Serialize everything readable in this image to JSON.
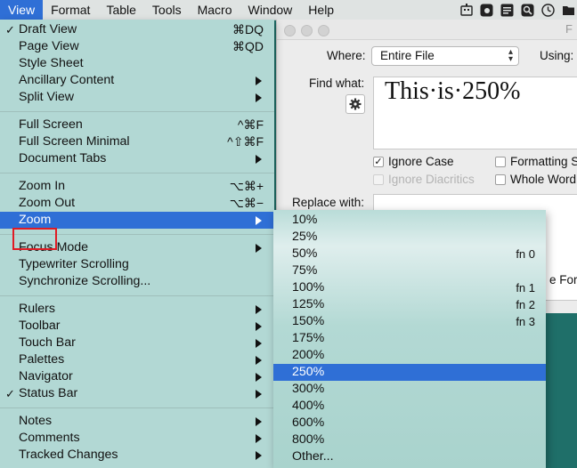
{
  "menubar": {
    "items": [
      "View",
      "Format",
      "Table",
      "Tools",
      "Macro",
      "Window",
      "Help"
    ],
    "active": "View"
  },
  "find_window": {
    "title": "F",
    "where_label": "Where:",
    "where_value": "Entire File",
    "using_label": "Using:",
    "find_label": "Find what:",
    "find_value": "This·is·250%",
    "replace_label": "Replace with:",
    "checkboxes": [
      {
        "label": "Ignore Case",
        "checked": true,
        "enabled": true
      },
      {
        "label": "Formatting S",
        "checked": false,
        "enabled": true
      },
      {
        "label": "Ignore Diacritics",
        "checked": false,
        "enabled": false
      },
      {
        "label": "Whole Word",
        "checked": false,
        "enabled": true
      }
    ],
    "replace_formatting_label": "e Forr"
  },
  "view_menu": {
    "items": [
      {
        "label": "Draft View",
        "shortcut": "⌘DQ",
        "checked": true
      },
      {
        "label": "Page View",
        "shortcut": "⌘QD"
      },
      {
        "label": "Style Sheet"
      },
      {
        "label": "Ancillary Content",
        "submenu": true
      },
      {
        "label": "Split View",
        "submenu": true
      },
      {
        "label": "Full Screen",
        "shortcut": "^⌘F"
      },
      {
        "label": "Full Screen Minimal",
        "shortcut": "^⇧⌘F"
      },
      {
        "label": "Document Tabs",
        "submenu": true
      },
      {
        "label": "Zoom In",
        "shortcut": "⌥⌘+"
      },
      {
        "label": "Zoom Out",
        "shortcut": "⌥⌘−"
      },
      {
        "label": "Zoom",
        "submenu": true,
        "highlighted": true
      },
      {
        "label": "Focus Mode",
        "submenu": true
      },
      {
        "label": "Typewriter Scrolling"
      },
      {
        "label": "Synchronize Scrolling..."
      },
      {
        "label": "Rulers",
        "submenu": true
      },
      {
        "label": "Toolbar",
        "submenu": true
      },
      {
        "label": "Touch Bar",
        "submenu": true
      },
      {
        "label": "Palettes",
        "submenu": true
      },
      {
        "label": "Navigator",
        "submenu": true
      },
      {
        "label": "Status Bar",
        "submenu": true,
        "checked": true
      },
      {
        "label": "Notes",
        "submenu": true
      },
      {
        "label": "Comments",
        "submenu": true
      },
      {
        "label": "Tracked Changes",
        "submenu": true
      }
    ]
  },
  "zoom_submenu": {
    "items": [
      {
        "label": "10%"
      },
      {
        "label": "25%"
      },
      {
        "label": "50%",
        "shortcut": "fn 0"
      },
      {
        "label": "75%"
      },
      {
        "label": "100%",
        "shortcut": "fn 1"
      },
      {
        "label": "125%",
        "shortcut": "fn 2"
      },
      {
        "label": "150%",
        "shortcut": "fn 3"
      },
      {
        "label": "175%"
      },
      {
        "label": "200%"
      },
      {
        "label": "250%",
        "highlighted": true
      },
      {
        "label": "300%"
      },
      {
        "label": "400%"
      },
      {
        "label": "600%"
      },
      {
        "label": "800%"
      },
      {
        "label": "Other..."
      }
    ]
  },
  "colors": {
    "highlight": "#2f6fd6",
    "menu_bg": "#b2d8d4",
    "desktop": "#1f6f69",
    "annotation": "#e01b24"
  }
}
